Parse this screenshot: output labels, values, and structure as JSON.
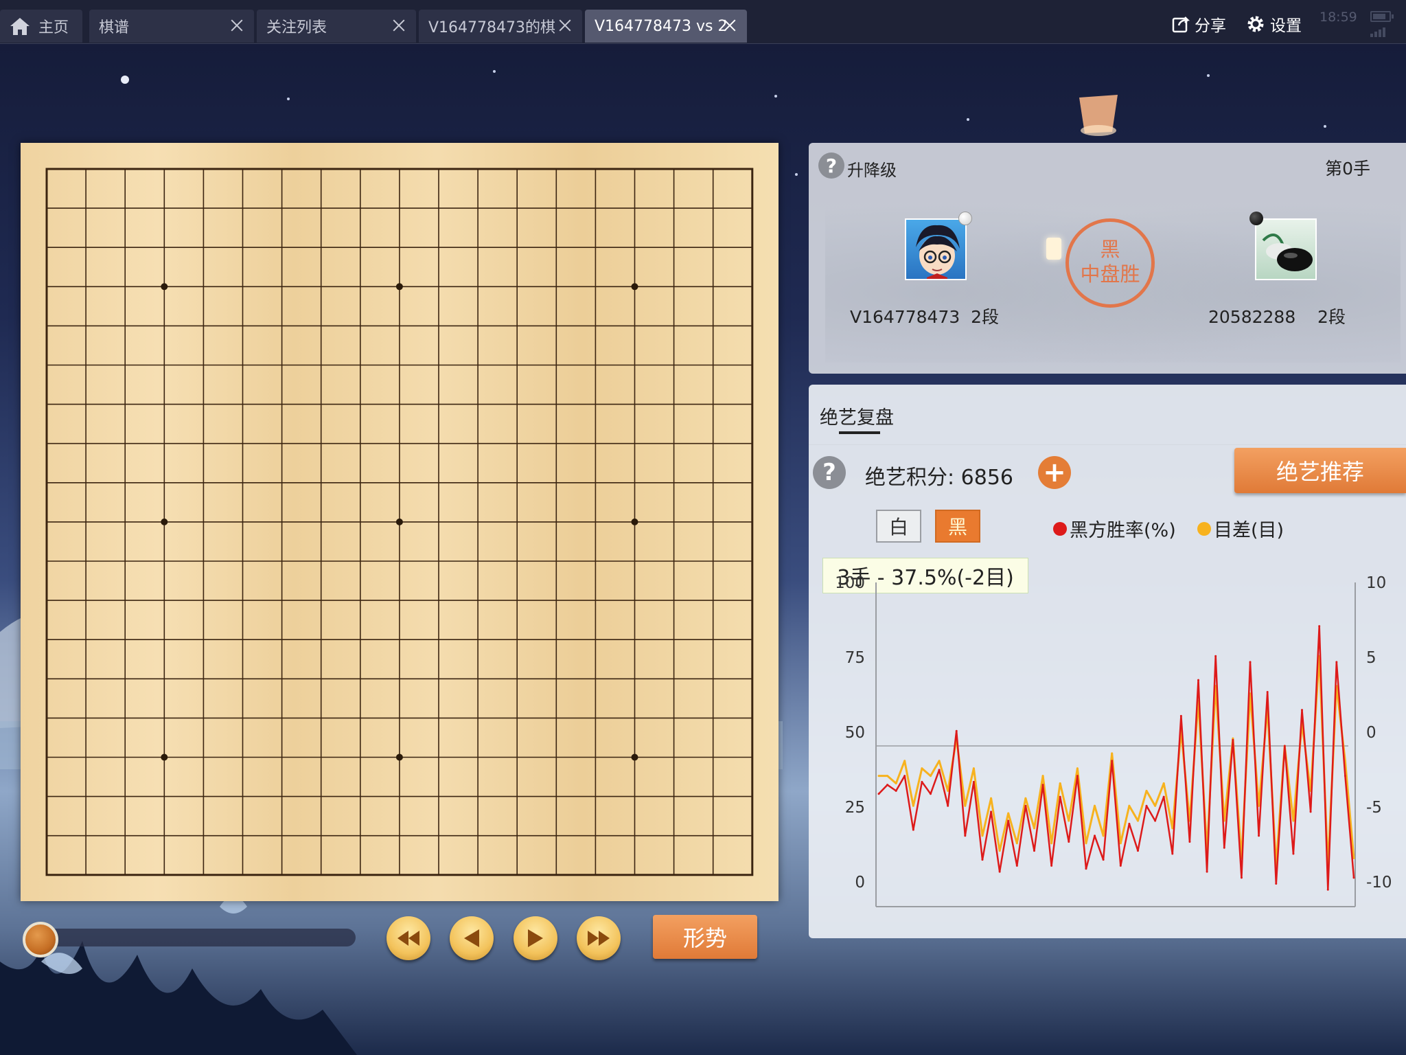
{
  "tabs": [
    {
      "label": "主页",
      "active": false
    },
    {
      "label": "棋谱",
      "active": false
    },
    {
      "label": "关注列表",
      "active": false
    },
    {
      "label": "V164778473的棋",
      "active": false
    },
    {
      "label": "V164778473 vs 2",
      "active": true
    }
  ],
  "top_actions": {
    "share": "分享",
    "settings": "设置"
  },
  "status_bar": {
    "time": "18:59"
  },
  "board": {
    "size": 19,
    "star_points": [
      [
        3,
        3
      ],
      [
        9,
        3
      ],
      [
        15,
        3
      ],
      [
        3,
        9
      ],
      [
        9,
        9
      ],
      [
        15,
        9
      ],
      [
        3,
        15
      ],
      [
        9,
        15
      ],
      [
        15,
        15
      ]
    ]
  },
  "playback": {
    "progress": 0,
    "trend_label": "形势"
  },
  "game_info": {
    "rank_change_label": "升降级",
    "move_label": "第0手",
    "white_player": {
      "name": "V164778473",
      "rank": "2段",
      "stone": "white"
    },
    "black_player": {
      "name": "20582288",
      "rank": "2段",
      "stone": "black"
    },
    "result_line1": "黑",
    "result_line2": "中盘胜"
  },
  "analysis": {
    "tab_label": "绝艺复盘",
    "score_label": "绝艺积分: 6856",
    "recommend_label": "绝艺推荐",
    "side_white": "白",
    "side_black": "黑",
    "legend_winrate": "黑方胜率(%)",
    "legend_diff": "目差(目)",
    "tooltip": "3手 - 37.5%(-2目)",
    "colors": {
      "winrate": "#dd1a1a",
      "diff": "#f7b21e",
      "accent": "#e47d36"
    }
  },
  "chart_data": {
    "type": "line",
    "title": "",
    "x": [
      1,
      8,
      15,
      22,
      29,
      36,
      43,
      50,
      57,
      64,
      71,
      78,
      85,
      92,
      99,
      106,
      113,
      120,
      127,
      134,
      141,
      148,
      155,
      162,
      169,
      176,
      183,
      190,
      197,
      204,
      211,
      218,
      225,
      232,
      239,
      246,
      253,
      260,
      267,
      274,
      281,
      288,
      295,
      302,
      309,
      316,
      323,
      330,
      337,
      344,
      351,
      358,
      365,
      372,
      379,
      386
    ],
    "series": [
      {
        "name": "黑方胜率(%)",
        "axis": "left",
        "values": [
          34,
          37,
          35,
          40,
          22,
          38,
          34,
          42,
          30,
          55,
          20,
          38,
          12,
          28,
          8,
          25,
          10,
          30,
          15,
          37,
          10,
          33,
          18,
          40,
          9,
          20,
          12,
          45,
          10,
          24,
          15,
          30,
          25,
          33,
          14,
          60,
          18,
          72,
          8,
          80,
          16,
          52,
          6,
          78,
          20,
          68,
          4,
          50,
          14,
          62,
          28,
          90,
          2,
          78,
          40,
          6
        ]
      },
      {
        "name": "目差(目)",
        "axis": "right",
        "values": [
          -2,
          -2,
          -2.5,
          -1,
          -4,
          -1.5,
          -2,
          -1,
          -3,
          0.5,
          -4,
          -1.5,
          -6,
          -3.5,
          -7,
          -4.5,
          -6.5,
          -3.5,
          -5.5,
          -2,
          -6.5,
          -2.5,
          -5,
          -1.5,
          -6.5,
          -4,
          -6,
          -0.5,
          -6.5,
          -4,
          -5,
          -3,
          -4,
          -2.5,
          -5.5,
          1,
          -5,
          3,
          -7,
          4,
          -5,
          0.5,
          -7.5,
          3.5,
          -4,
          2.5,
          -8,
          0,
          -5,
          1.5,
          -3,
          6,
          -8,
          4,
          -1,
          -7.5
        ]
      }
    ],
    "ylim_left": [
      0,
      100
    ],
    "ylim_right": [
      -10,
      10
    ],
    "left_ticks": [
      100,
      75,
      50,
      25,
      0
    ],
    "right_ticks": [
      10,
      5,
      0,
      -5,
      -10
    ],
    "reference_line": 50
  }
}
